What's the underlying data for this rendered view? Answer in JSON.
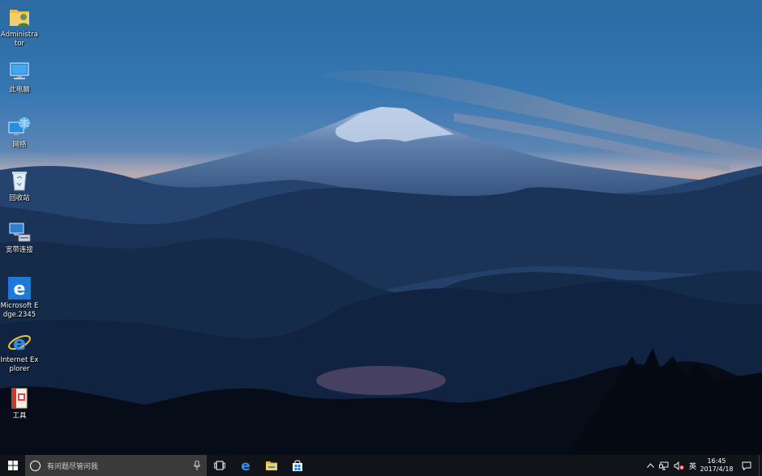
{
  "desktop": {
    "icons": [
      {
        "name": "user-folder",
        "label": "Administrator",
        "icon": "user-folder-icon"
      },
      {
        "name": "this-pc",
        "label": "此电脑",
        "icon": "computer-icon"
      },
      {
        "name": "network",
        "label": "网络",
        "icon": "network-globe-icon"
      },
      {
        "name": "recycle-bin",
        "label": "回收站",
        "icon": "recycle-bin-icon"
      },
      {
        "name": "broadband",
        "label": "宽带连接",
        "icon": "broadband-icon"
      },
      {
        "name": "edge-2345",
        "label": "Microsoft Edge.2345",
        "icon": "edge-icon"
      },
      {
        "name": "internet-explorer",
        "label": "Internet Explorer",
        "icon": "ie-icon"
      },
      {
        "name": "tools",
        "label": "工具",
        "icon": "tools-icon"
      }
    ]
  },
  "taskbar": {
    "search_placeholder": "有问题尽管问我",
    "pinned": [
      "task-view-icon",
      "edge-icon",
      "file-explorer-icon",
      "store-icon"
    ],
    "tray": {
      "ime": "英",
      "time": "16:45",
      "date": "2017/4/18"
    }
  },
  "colors": {
    "taskbar": "#101317",
    "search": "#3a3a3a",
    "accent": "#1e78d6"
  }
}
